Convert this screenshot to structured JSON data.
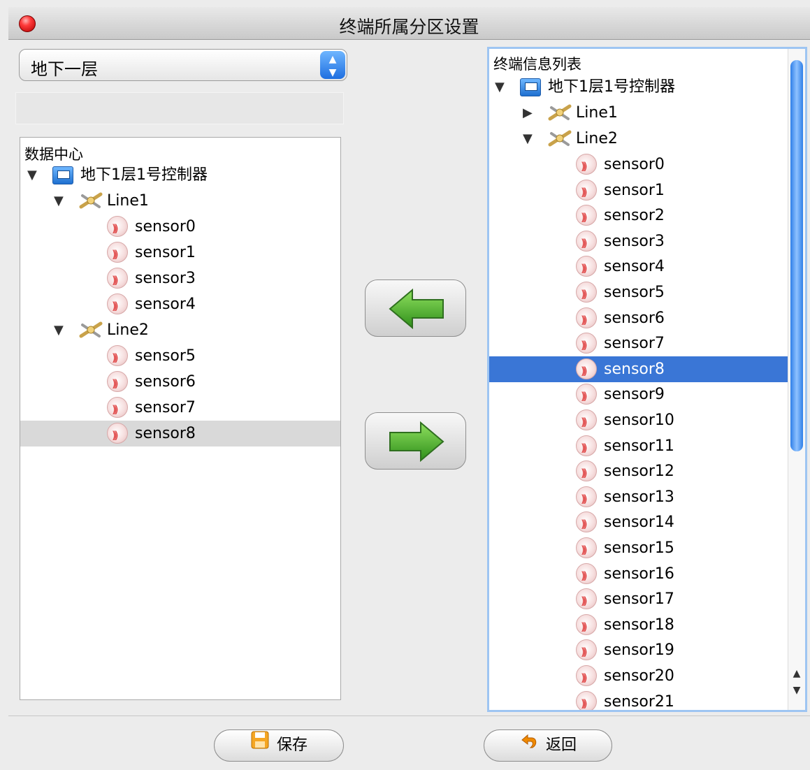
{
  "window": {
    "title": "终端所属分区设置"
  },
  "zone_select": {
    "value": "地下一层"
  },
  "left_tree": {
    "header": "数据中心",
    "controller": "地下1层1号控制器",
    "lines": [
      {
        "label": "Line1",
        "sensors": [
          "sensor0",
          "sensor1",
          "sensor3",
          "sensor4"
        ]
      },
      {
        "label": "Line2",
        "sensors": [
          "sensor5",
          "sensor6",
          "sensor7",
          "sensor8"
        ]
      }
    ],
    "selected": "sensor8"
  },
  "right_tree": {
    "header": "终端信息列表",
    "controller": "地下1层1号控制器",
    "lines": [
      {
        "label": "Line1",
        "expanded": false
      },
      {
        "label": "Line2",
        "expanded": true
      }
    ],
    "sensors": [
      "sensor0",
      "sensor1",
      "sensor2",
      "sensor3",
      "sensor4",
      "sensor5",
      "sensor6",
      "sensor7",
      "sensor8",
      "sensor9",
      "sensor10",
      "sensor11",
      "sensor12",
      "sensor13",
      "sensor14",
      "sensor15",
      "sensor16",
      "sensor17",
      "sensor18",
      "sensor19",
      "sensor20",
      "sensor21"
    ],
    "selected": "sensor8"
  },
  "buttons": {
    "save": "保存",
    "back": "返回"
  },
  "icons": {
    "close": "close-icon",
    "move_left": "arrow-left-icon",
    "move_right": "arrow-right-icon",
    "save": "floppy-icon",
    "back": "return-icon"
  },
  "colors": {
    "selection_blue": "#3a76d6",
    "selection_gray": "#d9d9d9",
    "arrow_green": "#4fae2a"
  }
}
